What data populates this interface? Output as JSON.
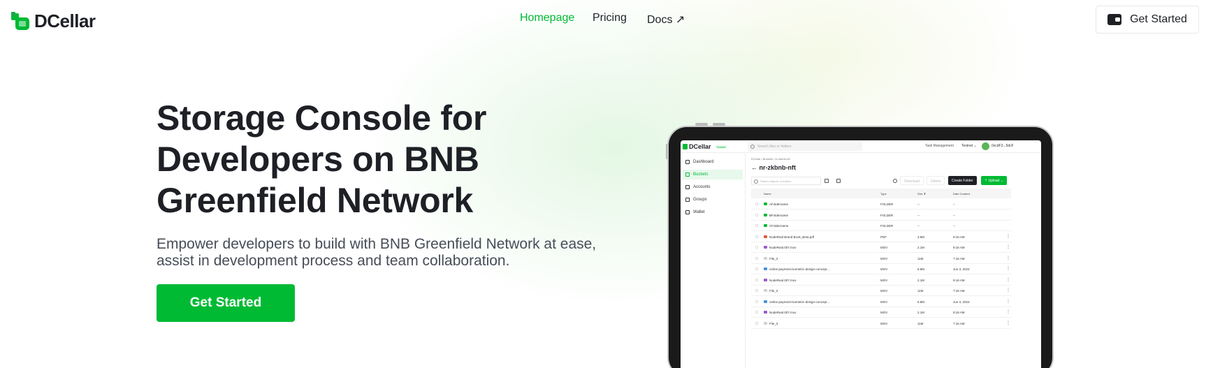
{
  "nav": {
    "brand": "DCellar",
    "links": [
      "Homepage",
      "Pricing",
      "Docs ↗"
    ],
    "active_link": "Homepage",
    "cta_label": "Get Started",
    "cta_icon": "wallet-icon"
  },
  "hero": {
    "title": "Storage Console for Developers on BNB Greenfield Network",
    "subtitle": "Empower developers to build with BNB Greenfield Network at ease, assist in development process and team collaboration.",
    "cta_label": "Get Started"
  },
  "colors": {
    "accent": "#00ba34",
    "text": "#1e2026",
    "muted": "#474d57"
  },
  "preview": {
    "brand": "DCellar",
    "network_tag": "Testnet",
    "search_placeholder": "Search files or folders",
    "task_management": "Task Management",
    "network": "Testnet ⌄",
    "address": "0xcdF3...5dcF",
    "sidebar": [
      "Dashboard",
      "Buckets",
      "Accounts",
      "Groups",
      "Wallet"
    ],
    "sidebar_active": "Buckets",
    "breadcrumb": "DCellar  /  Buckets  /  nr-zkbnb-nft",
    "bucket_title": "nr-zkbnb-nft",
    "filter_placeholder": "Search objects or folders",
    "buttons": {
      "download": "Download",
      "delete": "Delete",
      "create_folder": "Create Folder",
      "upload": "Upload"
    },
    "columns": [
      "Name",
      "Type",
      "Size ⬆",
      "Date Created"
    ],
    "rows": [
      {
        "name": "AFoldername",
        "type": "FOLDER",
        "size": "--",
        "date": "--",
        "kind": "folder"
      },
      {
        "name": "BFoldername",
        "type": "FOLDER",
        "size": "--",
        "date": "--",
        "kind": "folder"
      },
      {
        "name": "CFoldername",
        "type": "FOLDER",
        "size": "--",
        "date": "--",
        "kind": "folder"
      },
      {
        "name": "NodeReal Brand Book_Beta.pdf",
        "type": "PDF",
        "size": "3.5M",
        "date": "9:16 AM",
        "kind": "pdf"
      },
      {
        "name": "NodeReal.007.mov",
        "type": "MOV",
        "size": "2.1M",
        "date": "9:16 AM",
        "kind": "mov"
      },
      {
        "name": "File_3",
        "type": "MOV",
        "size": "11M",
        "date": "7:16 AM",
        "kind": "file"
      },
      {
        "name": "online-payment-isometric-design-concept...",
        "type": "MOV",
        "size": "6.8M",
        "date": "Jun 3, 2023",
        "kind": "img"
      },
      {
        "name": "NodeReal.007.mov",
        "type": "MOV",
        "size": "2.1M",
        "date": "9:16 AM",
        "kind": "mov"
      },
      {
        "name": "File_3",
        "type": "MOV",
        "size": "11M",
        "date": "7:16 AM",
        "kind": "file"
      },
      {
        "name": "online-payment-isometric-design-concept...",
        "type": "MOV",
        "size": "6.8M",
        "date": "Jun 3, 2023",
        "kind": "img"
      },
      {
        "name": "NodeReal.007.mov",
        "type": "MOV",
        "size": "2.1M",
        "date": "9:16 AM",
        "kind": "mov"
      },
      {
        "name": "File_3",
        "type": "MOV",
        "size": "11M",
        "date": "7:16 AM",
        "kind": "file"
      }
    ]
  }
}
